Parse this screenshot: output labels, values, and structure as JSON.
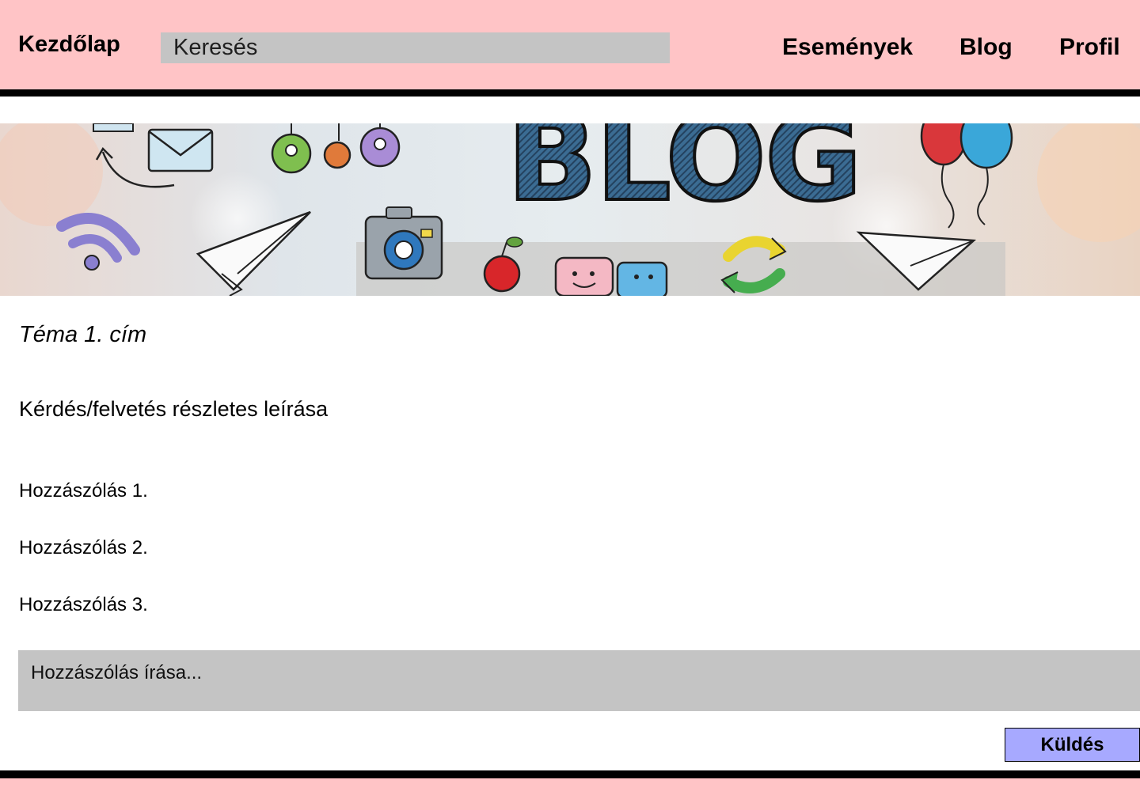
{
  "header": {
    "home_label": "Kezdőlap",
    "search_placeholder": "Keresés",
    "nav": {
      "events": "Események",
      "blog": "Blog",
      "profile": "Profil"
    }
  },
  "banner": {
    "text": "BLOG",
    "icons": [
      "envelope-icon",
      "people-icon",
      "wifi-icon",
      "paper-plane-icon",
      "camera-icon",
      "apple-icon",
      "chat-bubbles-icon",
      "refresh-arrows-icon",
      "balloons-icon"
    ]
  },
  "topic": {
    "title": "Téma 1. cím",
    "description": "Kérdés/felvetés részletes leírása"
  },
  "comments": [
    "Hozzászólás 1.",
    "Hozzászólás 2.",
    "Hozzászólás 3."
  ],
  "comment_form": {
    "placeholder": "Hozzászólás írása...",
    "submit_label": "Küldés"
  },
  "colors": {
    "header_bg": "#ffc4c6",
    "input_bg": "#c4c4c4",
    "button_bg": "#a7a9ff",
    "border": "#000000"
  }
}
